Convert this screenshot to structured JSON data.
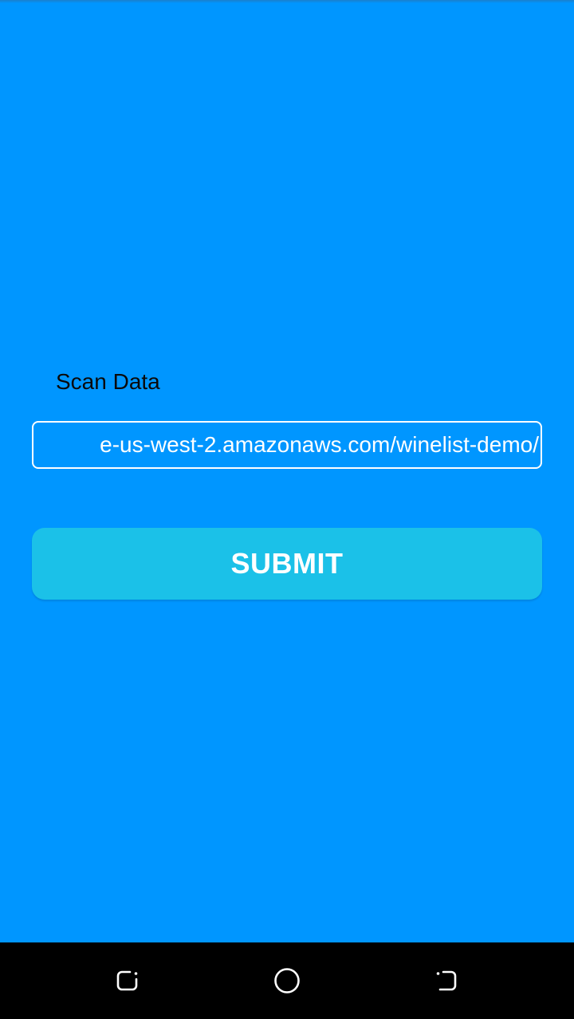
{
  "form": {
    "scan_label": "Scan Data",
    "scan_value": "e-us-west-2.amazonaws.com/winelist-demo/",
    "submit_label": "SUBMIT"
  },
  "nav_bar": {
    "buttons": [
      {
        "name": "recents",
        "icon": "recents-icon"
      },
      {
        "name": "home",
        "icon": "home-icon"
      },
      {
        "name": "back",
        "icon": "back-icon"
      }
    ]
  },
  "colors": {
    "background": "#0096ff",
    "button": "#1bc1e8",
    "nav_bar": "#000000",
    "field_border": "#ffffff"
  }
}
